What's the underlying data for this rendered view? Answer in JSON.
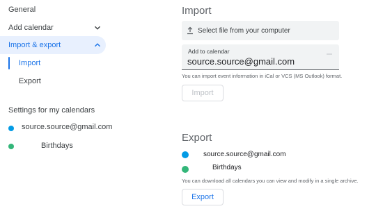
{
  "sidebar": {
    "general": "General",
    "add_calendar": "Add calendar",
    "import_export": "Import & export",
    "sub_import": "Import",
    "sub_export": "Export",
    "settings_header": "Settings for my calendars",
    "calendars": [
      {
        "label": "source.source@gmail.com",
        "color": "#039be5"
      },
      {
        "label": "Birthdays",
        "color": "#33b679"
      }
    ]
  },
  "import": {
    "title": "Import",
    "select_file": "Select file from your computer",
    "add_to_calendar_label": "Add to calendar",
    "add_to_calendar_value": "source.source@gmail.com",
    "helper": "You can import event information in iCal or VCS (MS Outlook) format.",
    "button": "Import"
  },
  "export": {
    "title": "Export",
    "calendars": [
      {
        "label": "source.source@gmail.com",
        "color": "#039be5"
      },
      {
        "label": "Birthdays",
        "color": "#33b679"
      }
    ],
    "helper": "You can download all calendars you can view and modify in a single archive.",
    "button": "Export"
  },
  "colors": {
    "accent": "#1a73e8",
    "active_bg": "#e8f0fe"
  }
}
